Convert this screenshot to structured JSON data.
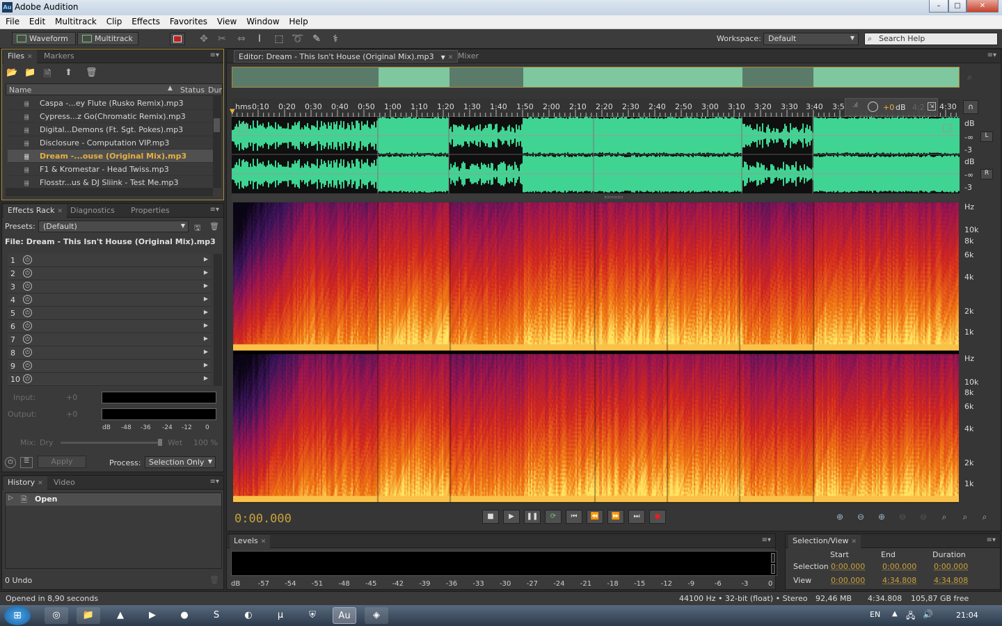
{
  "window": {
    "title": "Adobe Audition",
    "app_icon": "Au"
  },
  "menu": [
    "File",
    "Edit",
    "Multitrack",
    "Clip",
    "Effects",
    "Favorites",
    "View",
    "Window",
    "Help"
  ],
  "toolbar": {
    "waveform_label": "Waveform",
    "multitrack_label": "Multitrack",
    "workspace_label": "Workspace:",
    "workspace_value": "Default",
    "search_placeholder": "Search Help"
  },
  "files_panel": {
    "tabs": [
      "Files",
      "Markers"
    ],
    "columns": [
      "Name",
      "Status",
      "Dur"
    ],
    "files": [
      "Caspa -...ey Flute (Rusko Remix).mp3",
      "Cypress...z Go(Chromatic Remix).mp3",
      "Digital...Demons (Ft. Sgt. Pokes).mp3",
      "Disclosure - Computation VIP.mp3",
      "Dream -...ouse (Original Mix).mp3",
      "F1 & Kromestar - Head Twiss.mp3",
      "Flosstr...us & DJ Sliink - Test Me.mp3"
    ],
    "selected_index": 4
  },
  "effects_panel": {
    "tabs": [
      "Effects Rack",
      "Diagnostics",
      "Properties"
    ],
    "presets_label": "Presets:",
    "presets_value": "(Default)",
    "file_label": "File: Dream - This Isn't House (Original Mix).mp3",
    "slots": [
      "1",
      "2",
      "3",
      "4",
      "5",
      "6",
      "7",
      "8",
      "9",
      "10"
    ],
    "input_label": "Input:",
    "output_label": "Output:",
    "gain_in": "+0",
    "gain_out": "+0",
    "meter_ticks": [
      "dB",
      "-48",
      "-36",
      "-24",
      "-12",
      "0"
    ],
    "mix_label": "Mix:",
    "dry_label": "Dry",
    "wet_label": "Wet",
    "wet_value": "100 %",
    "apply_label": "Apply",
    "process_label": "Process:",
    "process_value": "Selection Only"
  },
  "history_panel": {
    "tabs": [
      "History",
      "Video"
    ],
    "items": [
      "Open"
    ],
    "undo_count": "0 Undo"
  },
  "editor": {
    "tab_label": "Editor: Dream - This Isn't House (Original Mix).mp3",
    "mixer_label": "Mixer",
    "ruler_start": "hms",
    "ruler": [
      "0:10",
      "0:20",
      "0:30",
      "0:40",
      "0:50",
      "1:00",
      "1:10",
      "1:20",
      "1:30",
      "1:40",
      "1:50",
      "2:00",
      "2:10",
      "2:20",
      "2:30",
      "2:40",
      "2:50",
      "3:00",
      "3:10",
      "3:20",
      "3:30",
      "3:40",
      "3:5",
      "4:30"
    ],
    "hud_gain": "+0",
    "hud_unit": "dB",
    "hud_faded_time": "4:2",
    "db_scale_left": [
      "dB",
      "-∞",
      "-3"
    ],
    "db_scale_right": [
      "dB",
      "-∞",
      "-3"
    ],
    "channel_left": "L",
    "channel_right": "R",
    "freq_scale_top": [
      "Hz",
      "10k",
      "8k",
      "6k",
      "4k",
      "2k",
      "1k"
    ],
    "freq_scale_bottom": [
      "Hz",
      "10k",
      "8k",
      "6k",
      "4k",
      "2k",
      "1k"
    ],
    "time_display": "0:00.000",
    "waveform_color": "#3fd492"
  },
  "levels_panel": {
    "tab": "Levels",
    "ticks": [
      "dB",
      "-57",
      "-54",
      "-51",
      "-48",
      "-45",
      "-42",
      "-39",
      "-36",
      "-33",
      "-30",
      "-27",
      "-24",
      "-21",
      "-18",
      "-15",
      "-12",
      "-9",
      "-6",
      "-3",
      "0"
    ]
  },
  "selection_view": {
    "tab": "Selection/View",
    "headers": [
      "Start",
      "End",
      "Duration"
    ],
    "rows": [
      {
        "label": "Selection",
        "start": "0:00.000",
        "end": "0:00.000",
        "duration": "0:00.000"
      },
      {
        "label": "View",
        "start": "0:00.000",
        "end": "4:34.808",
        "duration": "4:34.808"
      }
    ]
  },
  "status": {
    "message": "Opened in 8,90 seconds",
    "format": "44100 Hz • 32-bit (float) • Stereo",
    "size": "92,46 MB",
    "duration": "4:34.808",
    "free": "105,87 GB free"
  },
  "taskbar": {
    "lang": "EN",
    "clock": "21:04",
    "active_app": "Au"
  }
}
